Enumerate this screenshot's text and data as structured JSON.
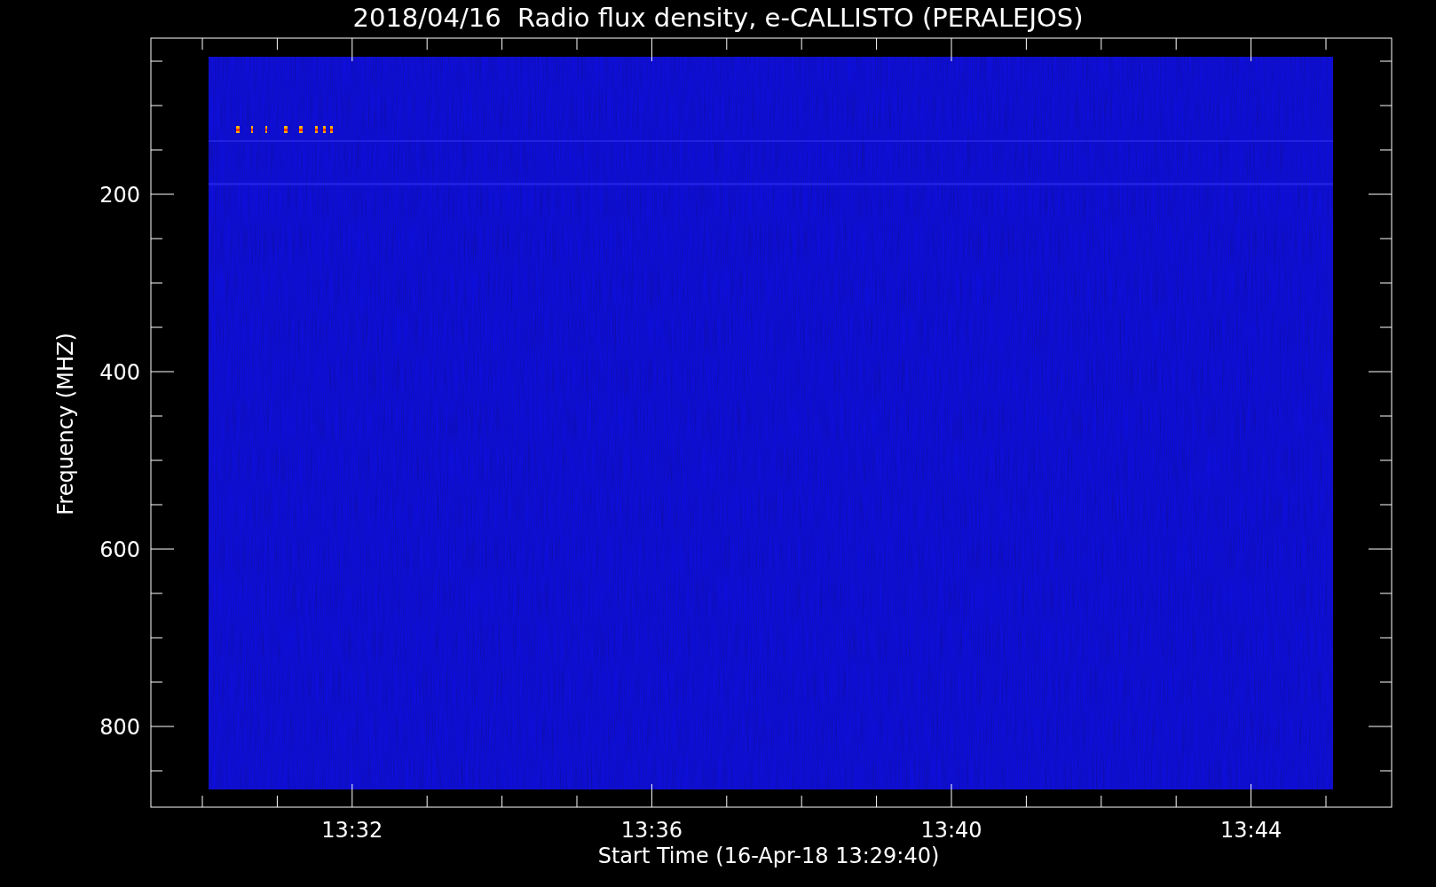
{
  "title": "2018/04/16  Radio flux density, e-CALLISTO (PERALEJOS)",
  "y_axis": {
    "label": "Frequency (MHZ)",
    "ticks": [
      "200",
      "400",
      "600",
      "800"
    ]
  },
  "x_axis": {
    "label": "Start Time (16-Apr-18 13:29:40)",
    "ticks": [
      "13:32",
      "13:36",
      "13:40",
      "13:44"
    ]
  }
}
